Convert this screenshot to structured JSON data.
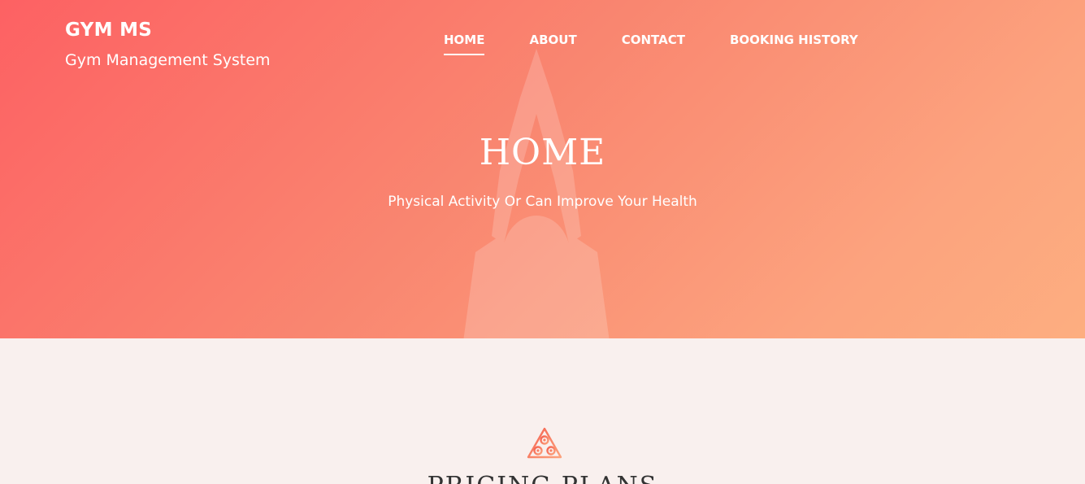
{
  "brand": {
    "title": "GYM MS",
    "subtitle": "Gym Management System"
  },
  "nav": {
    "items": [
      {
        "label": "HOME",
        "active": true
      },
      {
        "label": "ABOUT",
        "active": false
      },
      {
        "label": "CONTACT",
        "active": false
      },
      {
        "label": "BOOKING HISTORY",
        "active": false
      }
    ]
  },
  "hero": {
    "title": "HOME",
    "subtitle": "Physical Activity Or Can Improve Your Health",
    "gradient_colors": [
      "#fd6163",
      "#fdae80"
    ]
  },
  "pricing": {
    "icon": "triangle-logo-icon",
    "title": "PRICING PLANS",
    "accent": "#f5835d"
  }
}
